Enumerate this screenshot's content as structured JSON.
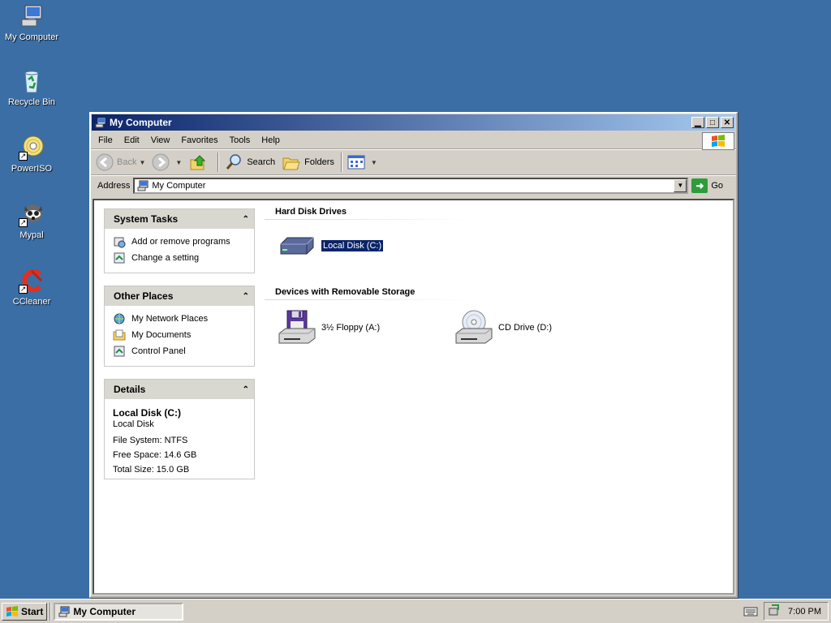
{
  "desktop": {
    "icons": [
      {
        "label": "My Computer"
      },
      {
        "label": "Recycle Bin"
      },
      {
        "label": "PowerISO"
      },
      {
        "label": "Mypal"
      },
      {
        "label": "CCleaner"
      }
    ]
  },
  "window": {
    "title": "My Computer",
    "menu": [
      "File",
      "Edit",
      "View",
      "Favorites",
      "Tools",
      "Help"
    ],
    "toolbar": {
      "back": "Back",
      "search": "Search",
      "folders": "Folders"
    },
    "address": {
      "label": "Address",
      "value": "My Computer",
      "go": "Go"
    }
  },
  "panes": {
    "system_tasks": {
      "title": "System Tasks",
      "items": [
        "Add or remove programs",
        "Change a setting"
      ]
    },
    "other_places": {
      "title": "Other Places",
      "items": [
        "My Network Places",
        "My Documents",
        "Control Panel"
      ]
    },
    "details": {
      "title": "Details",
      "name": "Local Disk (C:)",
      "type": "Local Disk",
      "file_system": "File System: NTFS",
      "free_space": "Free Space: 14.6 GB",
      "total_size": "Total Size: 15.0 GB"
    }
  },
  "main": {
    "hard_disk_title": "Hard Disk Drives",
    "removable_title": "Devices with Removable Storage",
    "drives": {
      "c": "Local Disk (C:)",
      "a": "3½ Floppy (A:)",
      "d": "CD Drive (D:)"
    }
  },
  "taskbar": {
    "start": "Start",
    "task": "My Computer",
    "clock": "7:00 PM"
  }
}
